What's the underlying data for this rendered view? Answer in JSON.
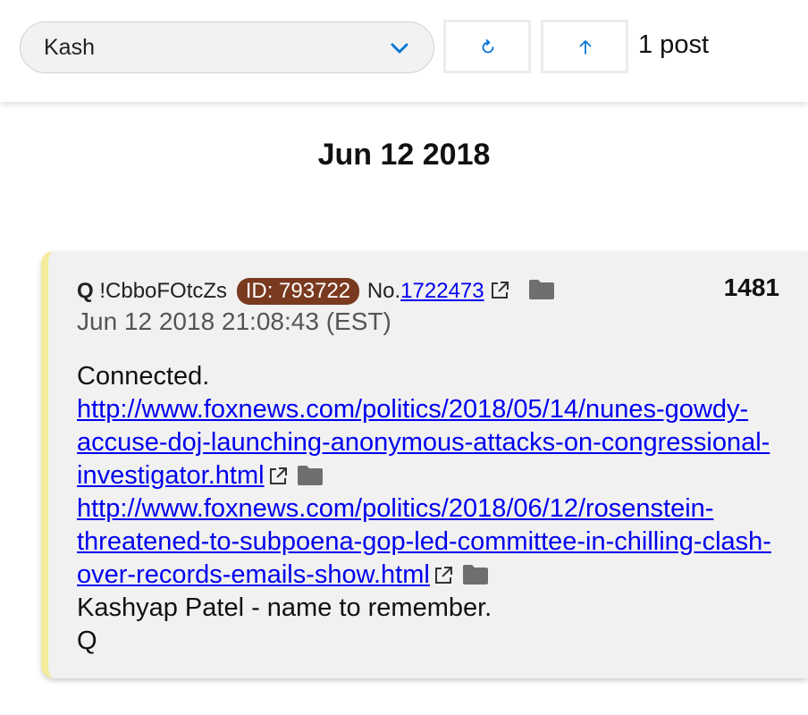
{
  "toolbar": {
    "filter_value": "Kash",
    "post_count": "1 post"
  },
  "date_header": "Jun 12 2018",
  "post": {
    "author": "Q",
    "tripcode": "!CbboFOtcZs",
    "id_badge": "ID: 793722",
    "no_prefix": "No.",
    "no_value": "1722473",
    "number": "1481",
    "timestamp": "Jun 12 2018 21:08:43 (EST)",
    "body": {
      "line1": "Connected.",
      "link1": "http://www.foxnews.com/politics/2018/05/14/nunes-gowdy-accuse-doj-launching-anonymous-attacks-on-congressional-investigator.html",
      "link2": "http://www.foxnews.com/politics/2018/06/12/rosenstein-threatened-to-subpoena-gop-led-committee-in-chilling-clash-over-records-emails-show.html",
      "line2": "Kashyap Patel - name to remember.",
      "signature": "Q"
    }
  },
  "colors": {
    "accent": "#0a78d6",
    "id_badge": "#7a3a1f",
    "post_border": "#f4ec9c",
    "link": "#0000ee"
  },
  "icons": [
    "chevron-down-icon",
    "refresh-icon",
    "arrow-up-icon",
    "external-link-icon",
    "folder-icon"
  ]
}
